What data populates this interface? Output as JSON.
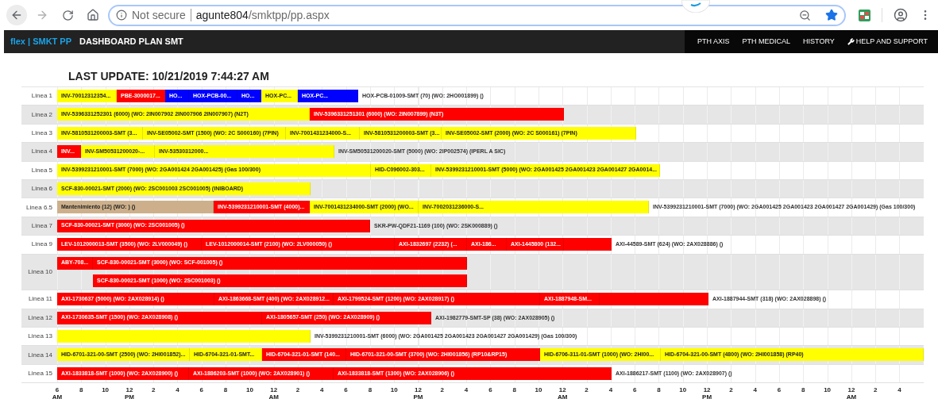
{
  "browser": {
    "security": "Not secure",
    "url_host": "agunte804",
    "url_path": "/smktpp/pp.aspx"
  },
  "navbar": {
    "brand": "flex | SMKT PP",
    "title": "DASHBOARD PLAN SMT",
    "links": [
      {
        "label": "PTH AXIS",
        "kind": "text"
      },
      {
        "label": "PTH MEDICAL",
        "kind": "text"
      },
      {
        "label": "HISTORY",
        "kind": "text"
      },
      {
        "label": "HELP AND SUPPORT",
        "kind": "help"
      }
    ]
  },
  "last_update": "LAST UPDATE: 10/21/2019 7:44:27 AM",
  "rows": [
    {
      "label": "Linea 1",
      "lanes": [
        {
          "bars": [
            {
              "label": "INV-70012312354...",
              "color": "#ffff00"
            },
            {
              "label": "PBE-3000017...",
              "color": "#ff0000"
            },
            {
              "label": "HO...",
              "color": "#0000ff"
            },
            {
              "label": "HOX-PCB-00...",
              "color": "#0000ff"
            },
            {
              "label": "HO...",
              "color": "#0000ff"
            },
            {
              "label": "HOX-PC...",
              "color": "#ffff00"
            },
            {
              "label": "HOX-PC...",
              "color": "#0000ff"
            }
          ],
          "note": "HOX-PCB-01009-SMT (70) (WO: 2HO001899) ()"
        }
      ]
    },
    {
      "label": "Linea 2",
      "lanes": [
        {
          "bars": [
            {
              "label": "INV-5396331252301 (6000) (WO: 2IN007902 2IN007906 2IN007907) (N2T)",
              "color": "#ffff00"
            },
            {
              "label": "INV-5396331251301 (6000) (WO: 2IN007899) (N3T)",
              "color": "#ff0000"
            }
          ]
        }
      ]
    },
    {
      "label": "Linea 3",
      "lanes": [
        {
          "bars": [
            {
              "label": "INV-5810531200003-SMT (3...",
              "color": "#ffff00"
            },
            {
              "label": "INV-SE05002-SMT (1500) (WO: 2C S000160) (7PIN)",
              "color": "#ffff00"
            },
            {
              "label": "INV-7001431234000-S...",
              "color": "#ffff00"
            },
            {
              "label": "INV-5810531200003-SMT (3...",
              "color": "#ffff00"
            },
            {
              "label": "INV-SE05002-SMT (2000) (WO: 2C S000161) (7PIN)",
              "color": "#ffff00"
            }
          ]
        }
      ]
    },
    {
      "label": "Linea 4",
      "lanes": [
        {
          "bars": [
            {
              "label": "INV...",
              "color": "#ff0000"
            },
            {
              "label": "INV-SM50531200020-...",
              "color": "#ffff00"
            },
            {
              "label": "INV-53530312000...",
              "color": "#ffff00"
            }
          ],
          "note": "INV-SM50531200020-SMT (5000) (WO: 2IP002574) (IPERL A SIC)"
        }
      ]
    },
    {
      "label": "Linea 5",
      "lanes": [
        {
          "bars": [
            {
              "label": "INV-5399231210001-SMT (7000) (WO: 2GA001424 2GA001425) (Gas 100/300)",
              "color": "#ffff00"
            },
            {
              "label": "HID-C096002-303...",
              "color": "#ffff00"
            },
            {
              "label": "INV-5399231210001-SMT (5000) (WO: 2GA001425 2GA001423 2GA001427 2GA0014...",
              "color": "#ffff00"
            }
          ]
        }
      ]
    },
    {
      "label": "Linea 6",
      "lanes": [
        {
          "bars": [
            {
              "label": "SCF-830-00021-SMT (2000) (WO: 2SC001003 2SC001005) (INIBOARD)",
              "color": "#ffff00"
            }
          ]
        }
      ]
    },
    {
      "label": "Linea 6.5",
      "lanes": [
        {
          "bars": [
            {
              "label": "Mantenimiento (12) (WO: ) ()",
              "color": "#cdb08b"
            },
            {
              "label": "INV-5399231210001-SMT (4000)...",
              "color": "#ff0000"
            },
            {
              "label": "INV-7001431234000-SMT (2000) (WO...",
              "color": "#ffff00"
            },
            {
              "label": "INV-7002031236000-S...",
              "color": "#ffff00"
            }
          ],
          "note": "INV-5399231210001-SMT (7000) (WO: 2GA001425 2GA001423 2GA001427 2GA001429) (Gas 100/300)"
        }
      ]
    },
    {
      "label": "Linea 7",
      "lanes": [
        {
          "bars": [
            {
              "label": "SCF-830-00021-SMT (3000) (WO: 2SC001005) ()",
              "color": "#ff0000"
            }
          ],
          "note": "SKR-PW-QDF21-1169 (100) (WO: 2SK000889) ()"
        }
      ]
    },
    {
      "label": "Linea 9",
      "lanes": [
        {
          "bars": [
            {
              "label": "LEV-1012000013-SMT (3500) (WO: 2LV000049) ()",
              "color": "#ff0000"
            },
            {
              "label": "LEV-1012000014-SMT (2100) (WO: 2LV000050) ()",
              "color": "#ff0000"
            },
            {
              "label": "AXI-1832697 (2232) (...",
              "color": "#ff0000"
            },
            {
              "label": "AXI-186...",
              "color": "#ff0000"
            },
            {
              "label": "AXI-1445800 (132...",
              "color": "#ff0000"
            },
            {
              "color": "#ff0000"
            }
          ],
          "note": "AXI-44589-SMT (624) (WO: 2AX028886) ()"
        }
      ]
    },
    {
      "label": "Linea 10",
      "lanes": [
        {
          "bars": [
            {
              "label": "ABY-708...",
              "color": "#ff0000"
            },
            {
              "label": "SCF-830-00021-SMT (3000) (WO: SCF-001005) ()",
              "color": "#ff0000"
            }
          ]
        },
        {
          "bars": [
            {
              "label": "SCF-830-00021-SMT (1000) (WO: 2SC001003) ()",
              "color": "#ff0000"
            }
          ]
        }
      ]
    },
    {
      "label": "Linea 11",
      "lanes": [
        {
          "bars": [
            {
              "label": "AXI-1730637 (5000) (WO: 2AX028914) ()",
              "color": "#ff0000"
            },
            {
              "label": "AXI-1863668-SMT (400) (WO: 2AX028912...",
              "color": "#ff0000"
            },
            {
              "label": "AXI-1799524-SMT (1200) (WO: 2AX028917) ()",
              "color": "#ff0000"
            },
            {
              "label": "AXI-1887948-SM...",
              "color": "#ff0000"
            },
            {
              "color": "#ff0000"
            }
          ],
          "note": "AXI-1887944-SMT (318) (WO: 2AX028898) ()"
        }
      ]
    },
    {
      "label": "Linea 12",
      "lanes": [
        {
          "bars": [
            {
              "label": "AXI-1730635-SMT (1500) (WO: 2AX028908) ()",
              "color": "#ff0000"
            },
            {
              "label": "AXI-1805657-SMT (250) (WO: 2AX028909) ()",
              "color": "#ff0000"
            }
          ],
          "note": "AXI-1982779-SMT-SP (38) (WO: 2AX028905) ()"
        }
      ]
    },
    {
      "label": "Linea 13",
      "lanes": [
        {
          "bars": [
            {
              "color": "#ffff00"
            }
          ],
          "note": "INV-5399231210001-SMT (6000) (WO: 2GA001425 2GA001423 2GA001427 2GA001429) (Gas 100/300)"
        }
      ]
    },
    {
      "label": "Linea 14",
      "lanes": [
        {
          "bars": [
            {
              "label": "HID-6701-321-00-SMT (2500) (WO: 2HI001852)...",
              "color": "#ffff00"
            },
            {
              "label": "HID-6704-321-01-SMT...",
              "color": "#ffff00"
            },
            {
              "label": "HID-6704-321-01-SMT (140...",
              "color": "#ff0000"
            },
            {
              "label": "HID-6701-321-00-SMT (3700) (WO: 2HI001856) (RP10&RP15)",
              "color": "#ff0000"
            },
            {
              "label": "HID-6706-311-01-SMT (1000) (WO: 2HI00...",
              "color": "#ffff00"
            },
            {
              "label": "HID-6704-321-00-SMT (4800) (WO: 2HI001858) (RP40)",
              "color": "#ffff00"
            }
          ]
        }
      ]
    },
    {
      "label": "Linea 15",
      "lanes": [
        {
          "bars": [
            {
              "label": "AXI-1833818-SMT (1000) (WO: 2AX028900) ()",
              "color": "#ff0000"
            },
            {
              "label": "AXI-1886203-SMT (1000) (WO: 2AX028901) ()",
              "color": "#ff0000"
            },
            {
              "label": "AXI-1833818-SMT (1300) (WO: 2AX028906) ()",
              "color": "#ff0000"
            }
          ],
          "note": "AXI-1886217-SMT (1100) (WO: 2AX028907) ()"
        }
      ]
    }
  ],
  "axis": [
    {
      "hour": "6",
      "period": "AM"
    },
    {
      "hour": "8"
    },
    {
      "hour": "10"
    },
    {
      "hour": "12",
      "period": "PM"
    },
    {
      "hour": "2"
    },
    {
      "hour": "4"
    },
    {
      "hour": "6"
    },
    {
      "hour": "8"
    },
    {
      "hour": "10"
    },
    {
      "hour": "12",
      "period": "AM"
    },
    {
      "hour": "2"
    },
    {
      "hour": "4"
    },
    {
      "hour": "6"
    },
    {
      "hour": "8"
    },
    {
      "hour": "10"
    },
    {
      "hour": "12",
      "period": "PM"
    },
    {
      "hour": "2"
    },
    {
      "hour": "4"
    },
    {
      "hour": "6"
    },
    {
      "hour": "8"
    },
    {
      "hour": "10"
    },
    {
      "hour": "12",
      "period": "AM"
    },
    {
      "hour": "2"
    },
    {
      "hour": "4"
    },
    {
      "hour": "6"
    },
    {
      "hour": "8"
    },
    {
      "hour": "10"
    },
    {
      "hour": "12",
      "period": "PM"
    },
    {
      "hour": "2"
    },
    {
      "hour": "4"
    },
    {
      "hour": "6"
    },
    {
      "hour": "8"
    },
    {
      "hour": "10"
    },
    {
      "hour": "12",
      "period": "AM"
    },
    {
      "hour": "2"
    },
    {
      "hour": "4"
    }
  ]
}
